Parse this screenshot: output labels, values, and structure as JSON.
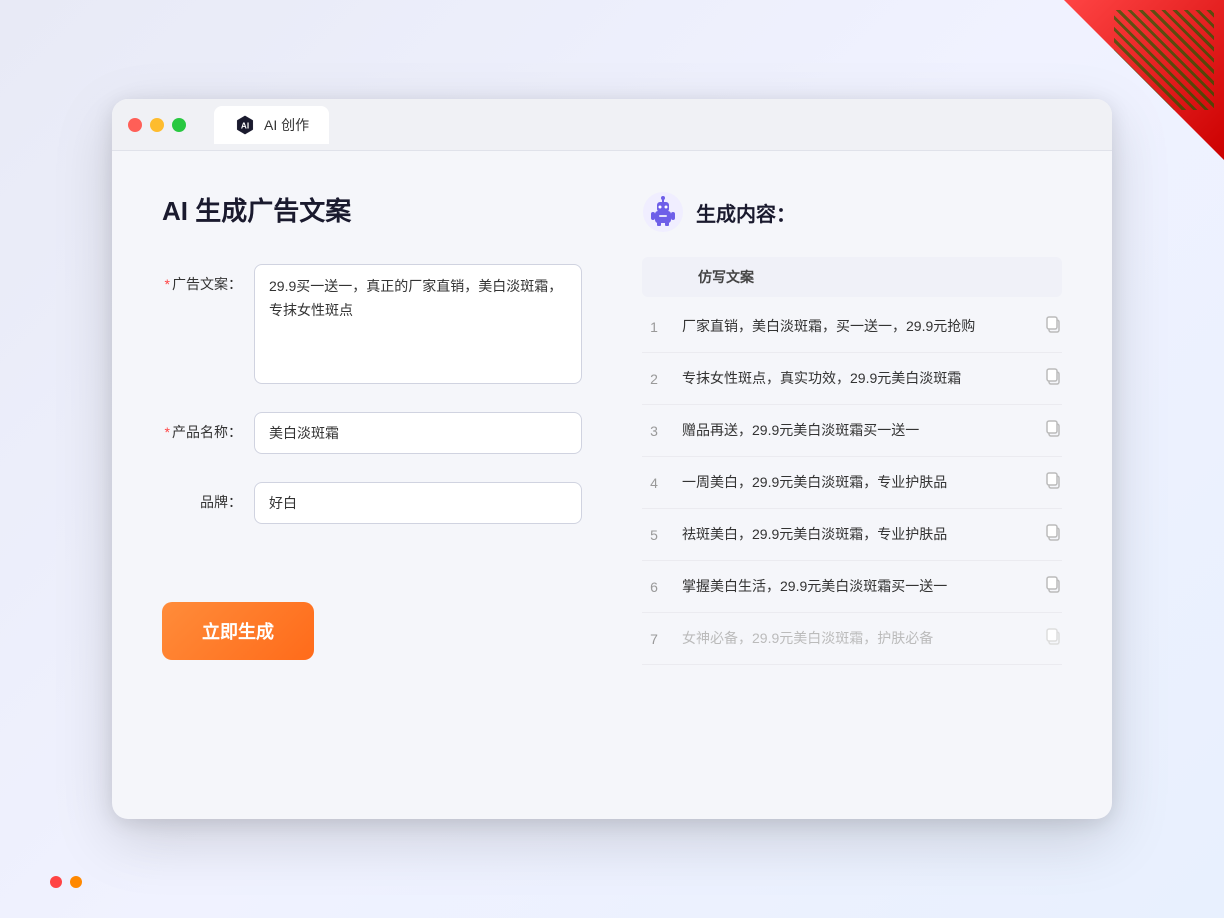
{
  "window": {
    "tab_label": "AI 创作"
  },
  "page": {
    "title": "AI 生成广告文案"
  },
  "form": {
    "ad_copy_label": "广告文案：",
    "ad_copy_required": "*",
    "ad_copy_value": "29.9买一送一，真正的厂家直销，美白淡斑霜，专抹女性斑点",
    "product_name_label": "产品名称：",
    "product_name_required": "*",
    "product_name_value": "美白淡斑霜",
    "brand_label": "品牌：",
    "brand_value": "好白",
    "generate_button": "立即生成"
  },
  "result": {
    "header_title": "生成内容：",
    "column_header": "仿写文案",
    "items": [
      {
        "num": "1",
        "text": "厂家直销，美白淡斑霜，买一送一，29.9元抢购",
        "muted": false
      },
      {
        "num": "2",
        "text": "专抹女性斑点，真实功效，29.9元美白淡斑霜",
        "muted": false
      },
      {
        "num": "3",
        "text": "赠品再送，29.9元美白淡斑霜买一送一",
        "muted": false
      },
      {
        "num": "4",
        "text": "一周美白，29.9元美白淡斑霜，专业护肤品",
        "muted": false
      },
      {
        "num": "5",
        "text": "祛斑美白，29.9元美白淡斑霜，专业护肤品",
        "muted": false
      },
      {
        "num": "6",
        "text": "掌握美白生活，29.9元美白淡斑霜买一送一",
        "muted": false
      },
      {
        "num": "7",
        "text": "女神必备，29.9元美白淡斑霜，护肤必备",
        "muted": true
      }
    ]
  },
  "colors": {
    "accent_orange": "#ff7a2f",
    "required_red": "#ff4444",
    "robot_purple": "#6e5fe8"
  }
}
